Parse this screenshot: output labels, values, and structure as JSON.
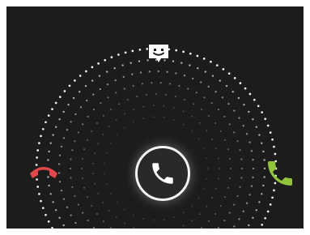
{
  "incoming_call": {
    "targets": [
      {
        "id": "reply",
        "icon": "sms-reply-icon",
        "color": "#ffffff"
      },
      {
        "id": "decline",
        "icon": "decline-call-icon",
        "color": "#e0484a"
      },
      {
        "id": "answer",
        "icon": "answer-call-icon",
        "color": "#8fc43b"
      }
    ],
    "handle": {
      "icon": "phone-icon",
      "color": "#ffffff"
    },
    "ring_dot_color": "#ffffff",
    "background_color": "#1c1c1c"
  }
}
